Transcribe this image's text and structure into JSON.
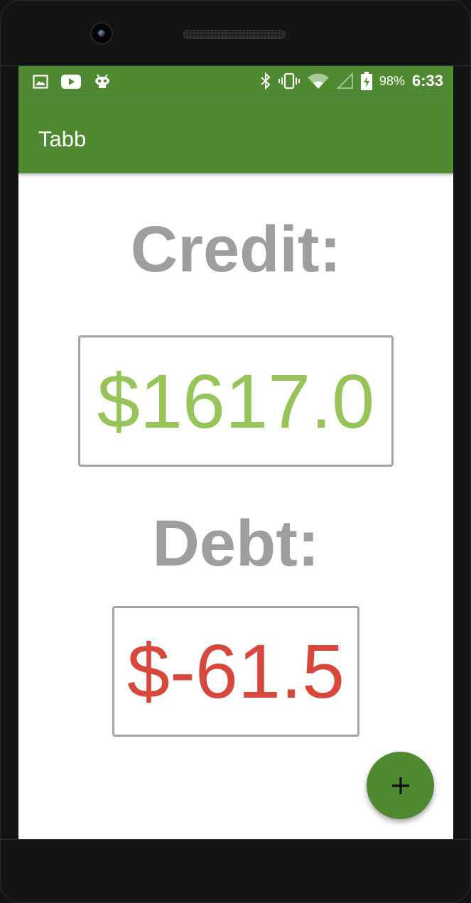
{
  "status_bar": {
    "left_icons": [
      "image-notification-icon",
      "youtube-notification-icon",
      "android-debug-icon"
    ],
    "right_icons": [
      "bluetooth-icon",
      "vibrate-icon",
      "wifi-icon",
      "cell-signal-icon",
      "battery-charging-icon"
    ],
    "battery_percent": "98%",
    "time": "6:33"
  },
  "app_bar": {
    "title": "Tabb"
  },
  "credit": {
    "label": "Credit:",
    "amount": "$1617.0"
  },
  "debt": {
    "label": "Debt:",
    "amount": "$-61.5"
  },
  "fab": {
    "icon": "plus-icon"
  },
  "colors": {
    "primary": "#4f8a33",
    "label_gray": "#9e9e9e",
    "credit_green": "#97c459",
    "debt_red": "#d8473c",
    "box_border": "#a3a3a3"
  }
}
